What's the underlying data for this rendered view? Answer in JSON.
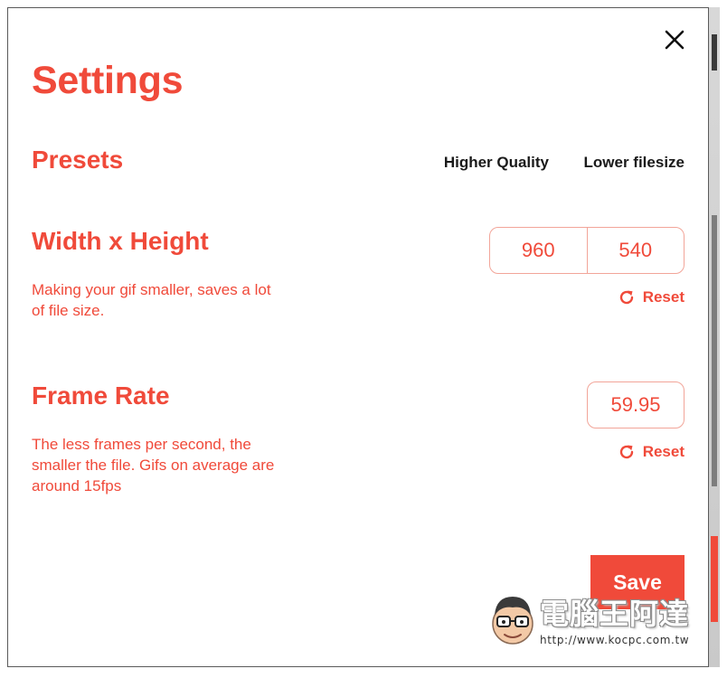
{
  "dialog": {
    "title": "Settings",
    "close_icon": "close-icon"
  },
  "presets": {
    "title": "Presets",
    "options": [
      "Higher Quality",
      "Lower filesize"
    ]
  },
  "dimensions": {
    "title": "Width x Height",
    "description": "Making your gif smaller, saves a lot of file size.",
    "width": "960",
    "height": "540",
    "reset_label": "Reset",
    "reset_icon": "reset-icon"
  },
  "frame_rate": {
    "title": "Frame Rate",
    "description": "The less frames per second, the smaller the file. Gifs on average are around 15fps",
    "value": "59.95",
    "reset_label": "Reset",
    "reset_icon": "reset-icon"
  },
  "actions": {
    "save_label": "Save"
  },
  "watermark": {
    "title": "電腦王阿達",
    "url": "http://www.kocpc.com.tw"
  },
  "colors": {
    "accent": "#f04a3a",
    "input_border": "#f2a599",
    "text_dark": "#1a1a1a",
    "background": "#ffffff"
  }
}
